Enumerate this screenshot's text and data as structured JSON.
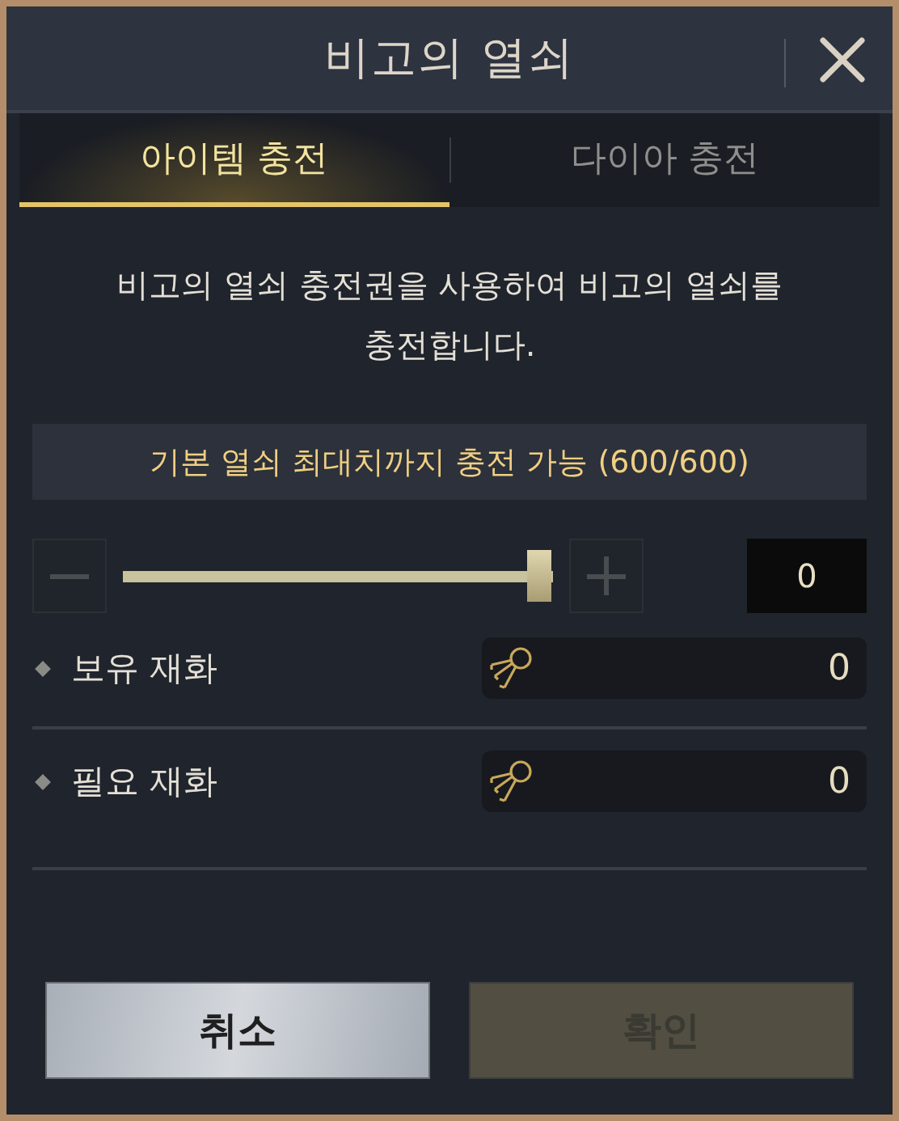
{
  "window": {
    "title": "비고의 열쇠"
  },
  "tabs": [
    {
      "label": "아이템 충전",
      "selected": true
    },
    {
      "label": "다이아 충전",
      "selected": false
    }
  ],
  "description": "비고의 열쇠 충전권을 사용하여 비고의 열쇠를 충전합니다.",
  "limit_notice": "기본 열쇠 최대치까지 충전 가능 (600/600)",
  "slider": {
    "level": 1.0,
    "quantity": "0"
  },
  "currencies": [
    {
      "label": "보유 재화",
      "value": "0"
    },
    {
      "label": "필요 재화",
      "value": "0"
    }
  ],
  "buttons": [
    {
      "label": "취소",
      "disabled": false
    },
    {
      "label": "확인",
      "disabled": true
    }
  ]
}
